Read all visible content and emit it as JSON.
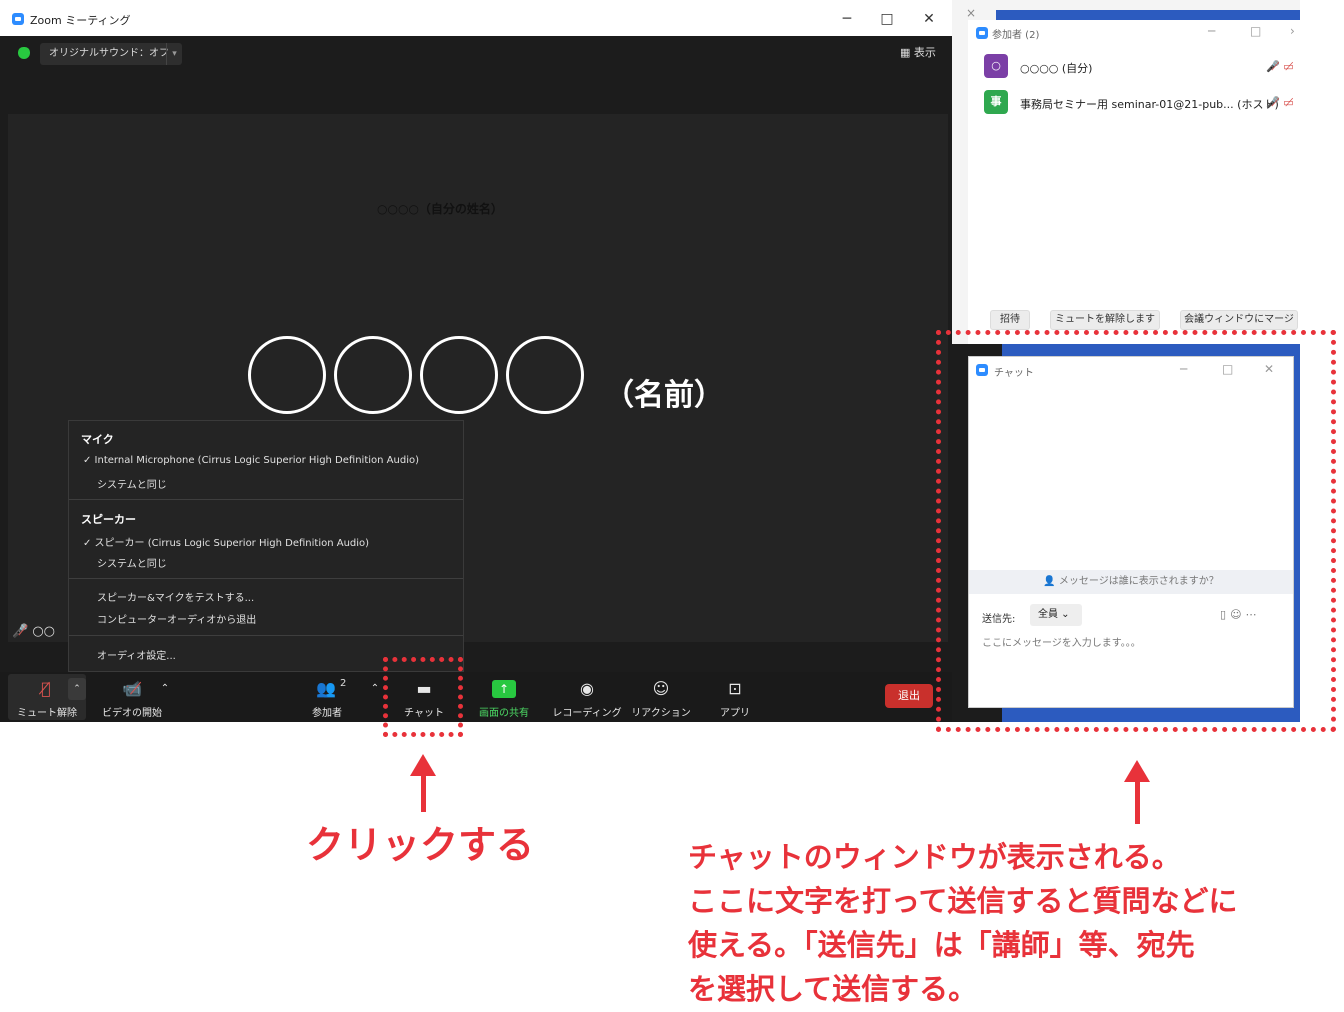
{
  "window": {
    "title": "Zoom ミーティング",
    "minimize": "─",
    "maximize": "□",
    "close": "✕"
  },
  "topbar": {
    "original_sound": "オリジナルサウンド：オフ",
    "view": "▦ 表示"
  },
  "video": {
    "self_label": "○○○○（自分の姓名）",
    "name_suffix": "（名前）",
    "name_tag": "○○"
  },
  "audio_menu": {
    "mic_heading": "マイク",
    "mic_option_1": "✓  Internal Microphone (Cirrus Logic Superior High Definition Audio)",
    "mic_option_2": "システムと同じ",
    "speaker_heading": "スピーカー",
    "speaker_option_1": "✓  スピーカー (Cirrus Logic Superior High Definition Audio)",
    "speaker_option_2": "システムと同じ",
    "test": "スピーカー&マイクをテストする...",
    "leave": "コンピューターオーディオから退出",
    "settings": "オーディオ設定..."
  },
  "toolbar": {
    "unmute": "ミュート解除",
    "start_video": "ビデオの開始",
    "participants": "参加者",
    "participants_count": "2",
    "chat": "チャット",
    "share": "画面の共有",
    "record": "レコーディング",
    "reactions": "リアクション",
    "apps": "アプリ",
    "exit": "退出"
  },
  "participants": {
    "title": "参加者 (2)",
    "items": [
      {
        "avatar": "○",
        "name": "○○○○ (自分)"
      },
      {
        "avatar": "事",
        "name": "事務局セミナー用 seminar-01@21-pub... (ホスト)"
      }
    ],
    "invite": "招待",
    "unmute_all": "ミュートを解除します",
    "merge": "会議ウィンドウにマージ"
  },
  "chat": {
    "title": "チャット",
    "hint": "メッセージは誰に表示されますか？",
    "send_to_label": "送信先:",
    "send_to_value": "全員 ⌄",
    "placeholder": "ここにメッセージを入力します。。。"
  },
  "annotations": {
    "click": "クリックする",
    "note_lines": [
      "チャットのウィンドウが表示される。",
      "ここに文字を打って送信すると質問などに",
      "使える。「送信先」は「講師」等、宛先",
      "を選択して送信する。"
    ]
  },
  "colors": {
    "accent_red": "#e8323a",
    "zoom_blue": "#2d8cff",
    "share_green": "#28c840"
  }
}
